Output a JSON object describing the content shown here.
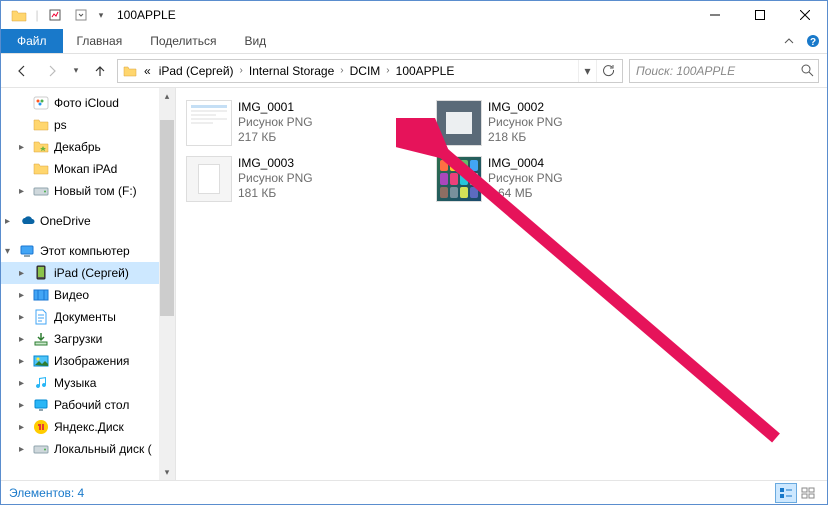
{
  "window": {
    "title": "100APPLE"
  },
  "ribbon": {
    "file": "Файл",
    "tabs": [
      "Главная",
      "Поделиться",
      "Вид"
    ]
  },
  "breadcrumb": {
    "prefix": "«",
    "items": [
      "iPad (Сергей)",
      "Internal Storage",
      "DCIM",
      "100APPLE"
    ]
  },
  "search": {
    "placeholder": "Поиск: 100APPLE"
  },
  "tree": {
    "items": [
      {
        "label": "Фото iCloud",
        "level": 1,
        "icon": "icloud-photo",
        "expander": ""
      },
      {
        "label": "ps",
        "level": 1,
        "icon": "folder",
        "expander": ""
      },
      {
        "label": "Декабрь",
        "level": 1,
        "icon": "folder-star",
        "expander": "▸"
      },
      {
        "label": "Мокап iPAd",
        "level": 1,
        "icon": "folder",
        "expander": ""
      },
      {
        "label": "Новый том (F:)",
        "level": 1,
        "icon": "drive",
        "expander": "▸"
      },
      {
        "label": "OneDrive",
        "level": 0,
        "icon": "onedrive",
        "expander": "▸",
        "spacer_before": true
      },
      {
        "label": "Этот компьютер",
        "level": 0,
        "icon": "pc",
        "expander": "▾",
        "spacer_before": true
      },
      {
        "label": "iPad (Сергей)",
        "level": 1,
        "icon": "ipad",
        "expander": "▸",
        "selected": true
      },
      {
        "label": "Видео",
        "level": 1,
        "icon": "video",
        "expander": "▸"
      },
      {
        "label": "Документы",
        "level": 1,
        "icon": "docs",
        "expander": "▸"
      },
      {
        "label": "Загрузки",
        "level": 1,
        "icon": "downloads",
        "expander": "▸"
      },
      {
        "label": "Изображения",
        "level": 1,
        "icon": "images",
        "expander": "▸"
      },
      {
        "label": "Музыка",
        "level": 1,
        "icon": "music",
        "expander": "▸"
      },
      {
        "label": "Рабочий стол",
        "level": 1,
        "icon": "desktop",
        "expander": "▸"
      },
      {
        "label": "Яндекс.Диск",
        "level": 1,
        "icon": "yadisk",
        "expander": "▸"
      },
      {
        "label": "Локальный диск (",
        "level": 1,
        "icon": "drive",
        "expander": "▸"
      }
    ]
  },
  "files": [
    {
      "name": "IMG_0001",
      "type": "Рисунок PNG",
      "size": "217 КБ",
      "thumb": "app"
    },
    {
      "name": "IMG_0002",
      "type": "Рисунок PNG",
      "size": "218 КБ",
      "thumb": "gray"
    },
    {
      "name": "IMG_0003",
      "type": "Рисунок PNG",
      "size": "181 КБ",
      "thumb": "light"
    },
    {
      "name": "IMG_0004",
      "type": "Рисунок PNG",
      "size": "5,64 МБ",
      "thumb": "color"
    }
  ],
  "status": {
    "label": "Элементов:",
    "count": "4"
  }
}
